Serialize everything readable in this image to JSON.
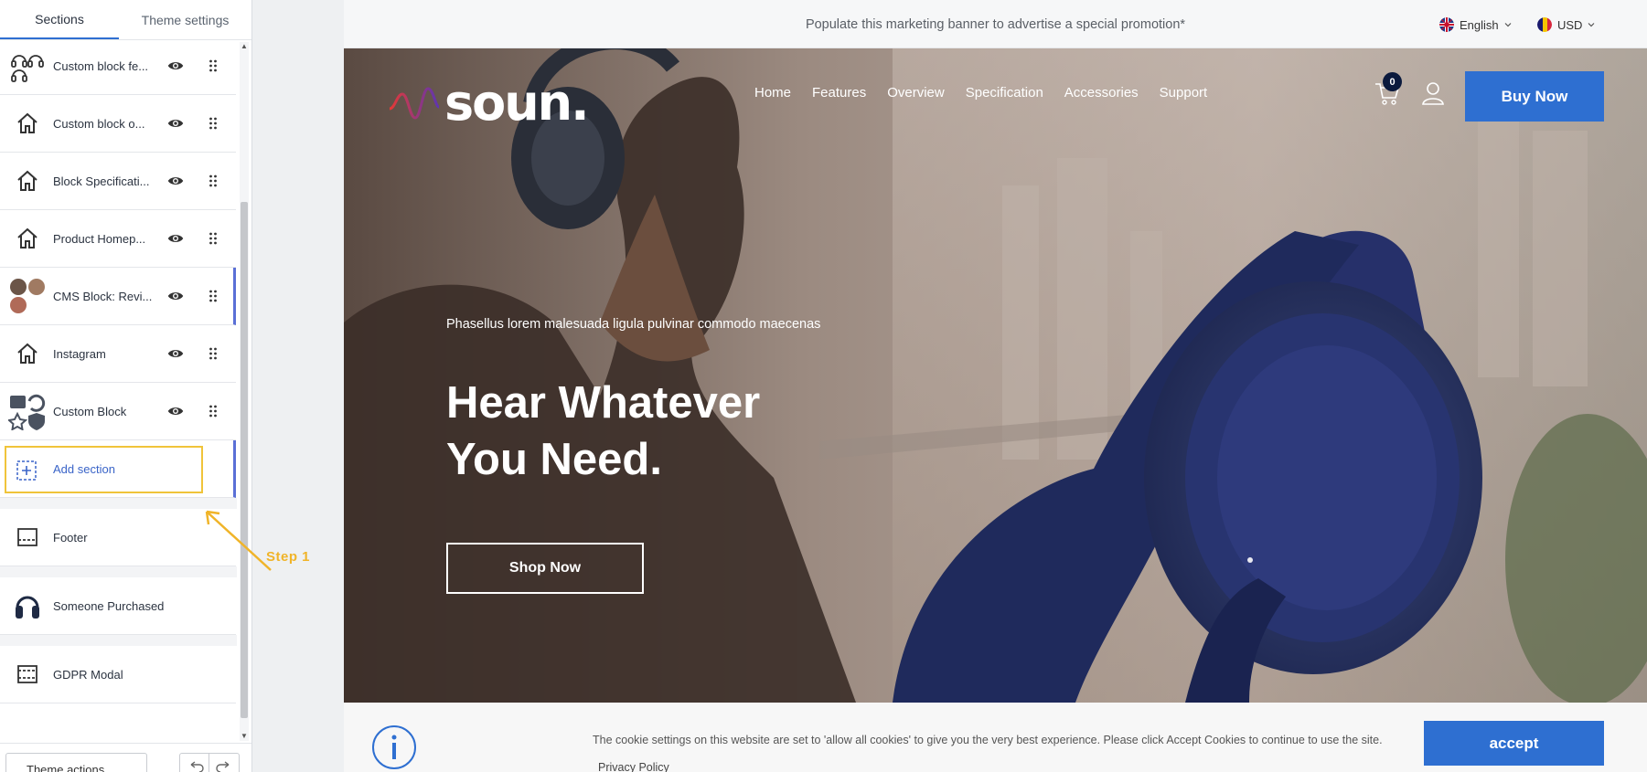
{
  "editor": {
    "tabs": [
      "Sections",
      "Theme settings"
    ],
    "sections": [
      {
        "label": "Custom block fe...",
        "icon": "headphones-icon"
      },
      {
        "label": "Custom block o...",
        "icon": "home-icon"
      },
      {
        "label": "Block Specificati...",
        "icon": "home-icon"
      },
      {
        "label": "Product Homep...",
        "icon": "home-icon"
      },
      {
        "label": "CMS Block: Revi...",
        "icon": "avatars-icon"
      },
      {
        "label": "Instagram",
        "icon": "home-icon"
      },
      {
        "label": "Custom Block",
        "icon": "features-icon"
      }
    ],
    "add_section": "Add section",
    "footer_sections": [
      {
        "label": "Footer",
        "icon": "footer-icon"
      },
      {
        "label": "Someone Purchased",
        "icon": "headphone-icon"
      },
      {
        "label": "GDPR Modal",
        "icon": "modal-icon"
      }
    ],
    "theme_actions": "Theme actions"
  },
  "annotation": {
    "step": "Step 1",
    "color": "#f0b429"
  },
  "preview": {
    "announcement": "Populate this marketing banner to advertise a special promotion*",
    "language": "English",
    "currency": "USD",
    "logo": "soun.",
    "nav": [
      "Home",
      "Features",
      "Overview",
      "Specification",
      "Accessories",
      "Support"
    ],
    "cart_count": "0",
    "buy_now": "Buy Now",
    "hero": {
      "kicker": "Phasellus lorem malesuada ligula pulvinar commodo maecenas",
      "headline_1": "Hear Whatever",
      "headline_2": "You Need.",
      "cta": "Shop Now"
    },
    "cookie": {
      "text": "The cookie settings on this website are set to 'allow all cookies' to give you the very best experience. Please click Accept Cookies to continue to use the site.",
      "policy_link": "Privacy Policy",
      "accept": "accept"
    }
  },
  "colors": {
    "accent": "#2e6fd1",
    "highlight": "#f0c43a",
    "active_bar": "#5a6fd6"
  }
}
